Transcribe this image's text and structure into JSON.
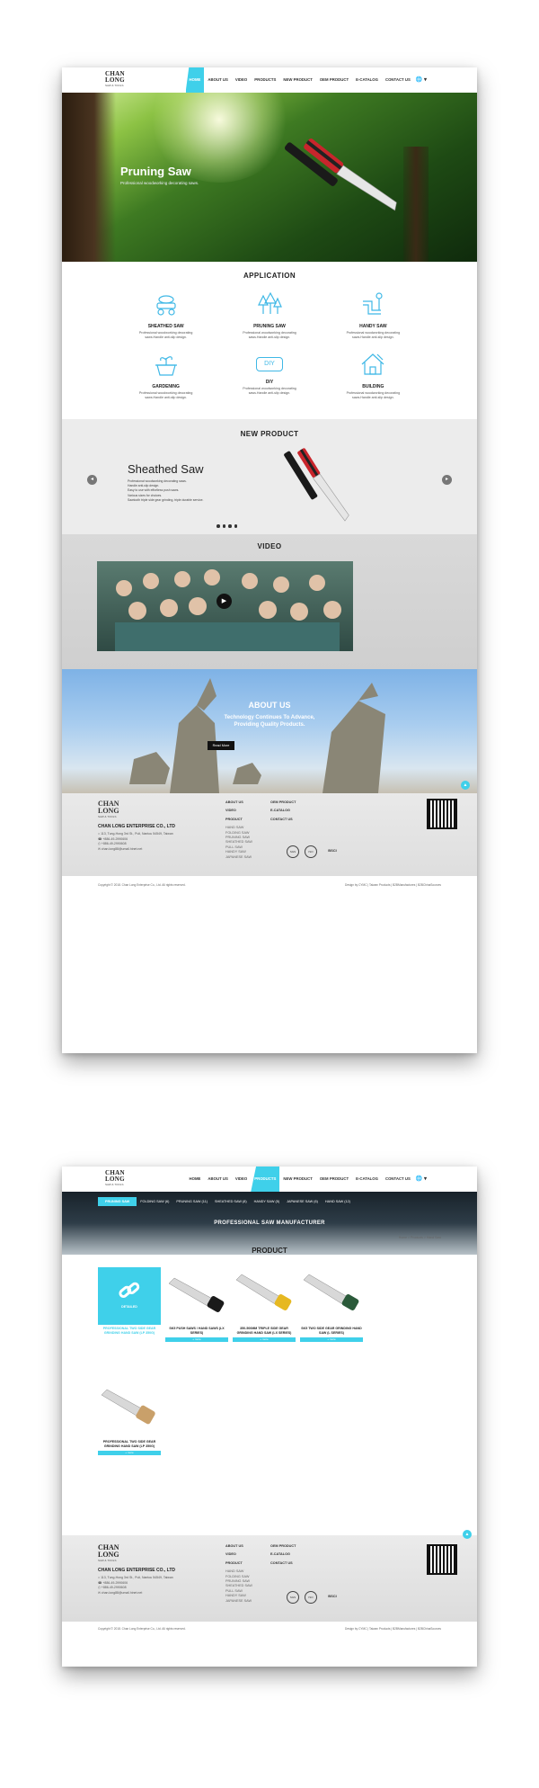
{
  "nav": {
    "logo_line1": "CHAN",
    "logo_line2": "LONG",
    "logo_sub": "SAW & TOOLS",
    "items": [
      "HOME",
      "ABOUT US",
      "VIDEO",
      "PRODUCTS",
      "NEW PRODUCT",
      "OEM PRODUCT",
      "E-CATALOG",
      "CONTACT US"
    ],
    "globe": "🌐 ▾"
  },
  "hero": {
    "title": "Pruning Saw",
    "subtitle": "Professional woodworking decorating saws."
  },
  "application": {
    "title": "APPLICATION",
    "items": [
      {
        "name": "SHEATHED SAW",
        "desc": "Professional woodworking decorating saws.Handle anti-slip design."
      },
      {
        "name": "PRUNING SAW",
        "desc": "Professional woodworking decorating saws.Handle anti-slip design."
      },
      {
        "name": "HANDY SAW",
        "desc": "Professional woodworking decorating saws.Handle anti-slip design."
      },
      {
        "name": "GARDENING",
        "desc": "Professional woodworking decorating saws.Handle anti-slip design."
      },
      {
        "name": "DIY",
        "desc": "Professional woodworking decorating saws.Handle anti-slip design."
      },
      {
        "name": "BUILDING",
        "desc": "Professional woodworking decorating saws.Handle anti-slip design."
      }
    ],
    "diy_icon_text": "DIY"
  },
  "new_product": {
    "title": "NEW PRODUCT",
    "name": "Sheathed Saw",
    "lines": [
      "Professional woodworking decorating saws.",
      "Handle anti-slip design.",
      "Easy to use with effortless push saws.",
      "Various sizes for choices.",
      "Sawtooth triple side gear grinding, triple durable service."
    ],
    "prev": "◂",
    "next": "▸"
  },
  "video": {
    "title": "VIDEO",
    "play": "▶"
  },
  "about": {
    "title": "ABOUT US",
    "tagline1": "Technology Continues To Advance,",
    "tagline2": "Providing Quality Products.",
    "button": "Read More",
    "top": "▲"
  },
  "footer": {
    "company": "CHAN LONG ENTERPRISE CO., LTD",
    "address": "113, Tung-Hong 3rd St., Puli, Nantou 54549, Taiwan",
    "tel": "+886-49-2990606",
    "fax": "+886-49-2990608",
    "email": "chan.long88@umail.hinet.net",
    "col1": [
      "ABOUT US",
      "VIDEO",
      "PRODUCT"
    ],
    "col1_sub": [
      "HAND SAW",
      "FOLDING SAW",
      "PRUNING SAW",
      "SHEATHED SAW",
      "PULL SAW",
      "HANDY SAW",
      "JAPANESE SAW"
    ],
    "col2": [
      "OEM PRODUCT",
      "E-CATALOG",
      "CONTACT US"
    ],
    "certs": [
      "SGS",
      "ISO",
      "BSCI"
    ],
    "copyright": "Copyright © 2018. Chan Long Enterprise Co., Ltd. All rights reserved.",
    "credits": "Design by CYMC  |  Taiwan Products  |  B2BManufactures  |  B2BChinaSources"
  },
  "page2": {
    "tabs": [
      "PRUNING SAW",
      "FOLDING SAW (6)",
      "PRUNING SAW (11)",
      "SHEATHED SAW (8)",
      "HANDY SAW (5)",
      "JAPANESE SAW (6)",
      "HAND SAW (12)"
    ],
    "banner_title": "PROFESSIONAL SAW MANUFACTURER",
    "breadcrumb": "Home > Products > Hand Saw",
    "title": "PRODUCT",
    "detail_label": "DETAILED",
    "more": "+ more",
    "products": [
      {
        "name": "PROFESSIONAL TWO SIDE GEAR GRINDING HAND SAW (LP 350G)"
      },
      {
        "name": "SK5 PUSH SAWS / HAND SAWS (LX SERIES)"
      },
      {
        "name": "350-500MM TRIPLE SIDE GEAR GRINDING HAND SAW (LX SERIES)"
      },
      {
        "name": "SK5 TWO SIDE GEAR GRINDING HAND SAW (L SERIES)"
      },
      {
        "name": "PROFESSIONAL TWO SIDE GEAR GRINDING HAND SAW (LP 350G)"
      }
    ]
  },
  "colors": {
    "accent": "#3fd0ea",
    "text": "#222222",
    "footer_bg": "#e4e4e4"
  }
}
